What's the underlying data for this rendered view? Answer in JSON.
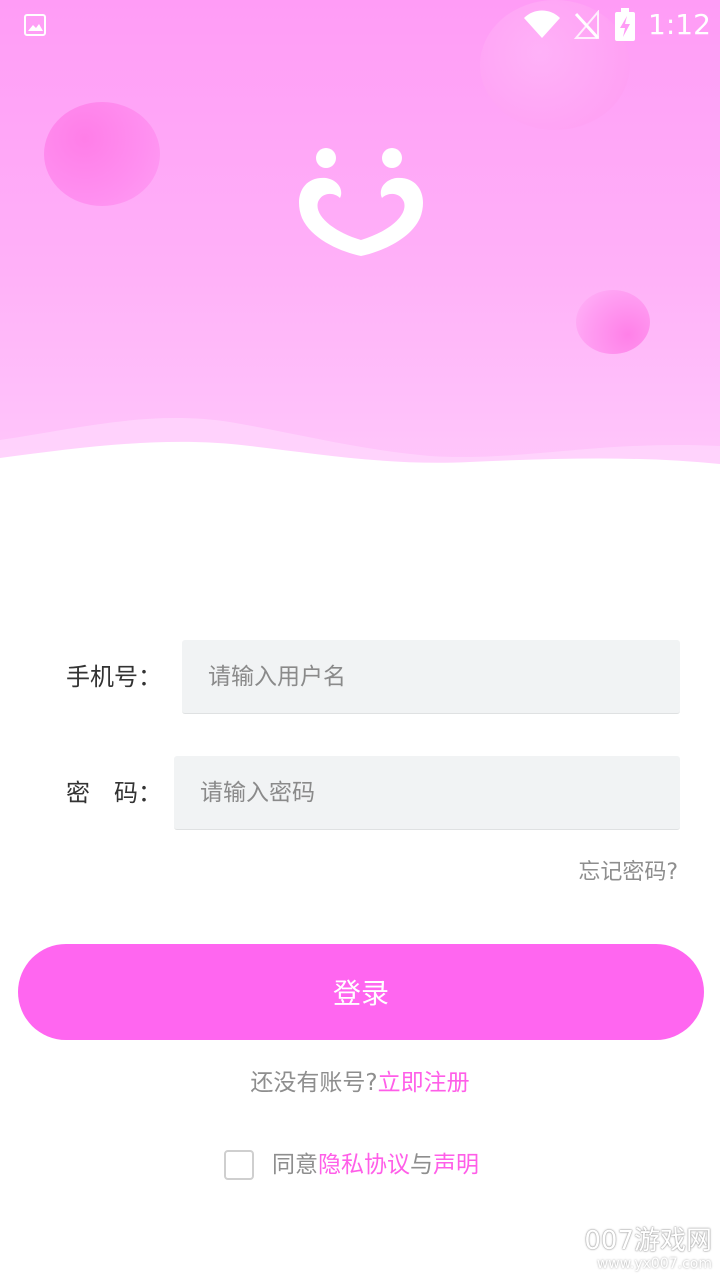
{
  "status_bar": {
    "time": "1:12",
    "icons": [
      "image-icon",
      "wifi-icon",
      "no-signal-icon",
      "battery-charging-icon"
    ]
  },
  "logo": {
    "icon": "heart-faces-logo"
  },
  "form": {
    "phone_label": "手机号：",
    "phone_placeholder": "请输入用户名",
    "password_label": "密　码：",
    "password_placeholder": "请输入密码",
    "forgot": "忘记密码?"
  },
  "login_button": "登录",
  "register": {
    "prompt": "还没有账号?",
    "link": "立即注册"
  },
  "agreement": {
    "prefix": "同意",
    "privacy": "隐私协议",
    "joiner": "与",
    "statement": "声明",
    "checked": false
  },
  "watermark": {
    "line1": "007游戏网",
    "line2": "www.yx007.com"
  },
  "colors": {
    "accent": "#ff66f0",
    "link": "#ff5ee8",
    "hero_top": "#ff9cf6",
    "hero_bottom": "#ffc8fb"
  }
}
